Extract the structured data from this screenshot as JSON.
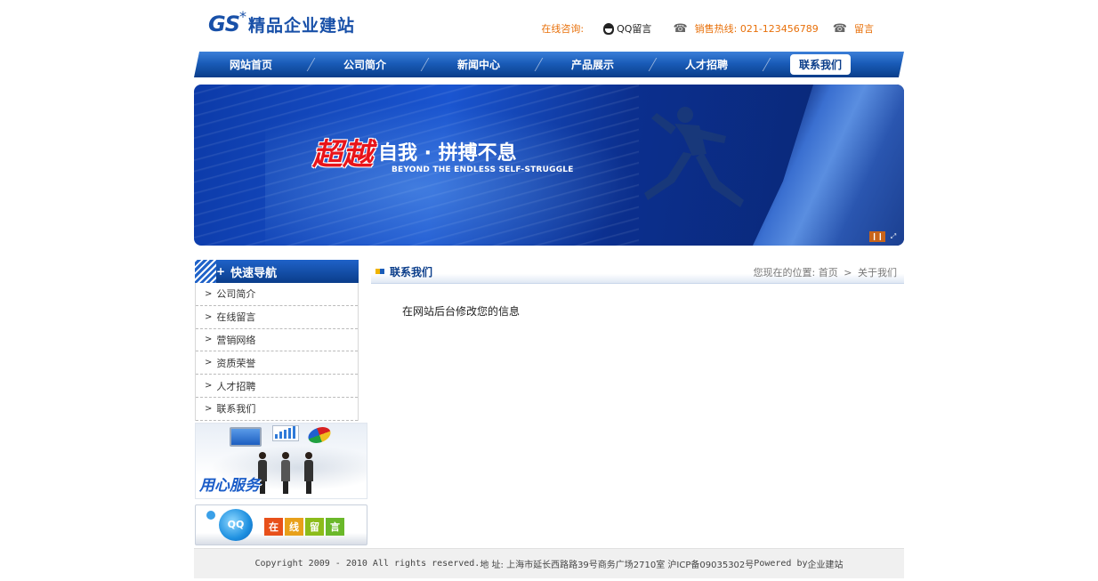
{
  "header": {
    "logo_mark": "GS",
    "logo_star": "*",
    "logo_text": "精品企业建站",
    "logo_reflect": "精品企业建站",
    "online_consult": "在线咨询:",
    "qq_label": "QQ留言",
    "hotline": "销售热线: 021-123456789",
    "message": "留言"
  },
  "nav": {
    "items": [
      {
        "label": "网站首页"
      },
      {
        "label": "公司简介"
      },
      {
        "label": "新闻中心"
      },
      {
        "label": "产品展示"
      },
      {
        "label": "人才招聘"
      },
      {
        "label": "联系我们",
        "active": true
      }
    ]
  },
  "banner": {
    "slogan_red": "超越",
    "slogan_white": "自我 · 拼搏不息",
    "slogan_en": "BEYOND THE ENDLESS SELF-STRUGGLE"
  },
  "sidebar": {
    "title": "快速导航",
    "items": [
      {
        "label": "公司简介"
      },
      {
        "label": "在线留言"
      },
      {
        "label": "营销网络"
      },
      {
        "label": "资质荣誉"
      },
      {
        "label": "人才招聘"
      },
      {
        "label": "联系我们"
      }
    ],
    "service_text": "用心服务",
    "message_buttons": [
      "在",
      "线",
      "留",
      "言"
    ],
    "message_colors": [
      "#e8501a",
      "#e8a01a",
      "#8cbc1a",
      "#6ab82a"
    ]
  },
  "main": {
    "title": "联系我们",
    "breadcrumb_prefix": "您现在的位置:",
    "breadcrumb_home": "首页",
    "breadcrumb_current": "关于我们",
    "body_text": "在网站后台修改您的信息"
  },
  "footer": {
    "copyright": "Copyright 2009 - 2010 All rights reserved.",
    "address": " 地 址: 上海市延长西路路39号商务广场2710室 沪ICP备09035302号",
    "powered": " Powered by ",
    "brand": "企业建站"
  },
  "colors": {
    "nav_blue": "#1a5cb8",
    "accent_orange": "#e8700a",
    "title_blue": "#0a3d8a"
  }
}
